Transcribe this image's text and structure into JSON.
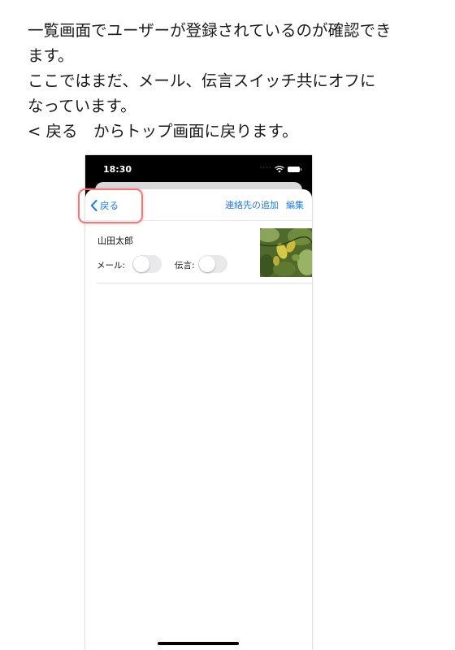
{
  "caption": {
    "lines": [
      "一覧画面でユーザーが登録されているのが確認でき",
      "ます。",
      "ここではまだ、メール、伝言スイッチ共にオフに",
      "なっています。",
      "< 戻る　からトップ画面に戻ります。"
    ]
  },
  "statusbar": {
    "time": "18:30"
  },
  "navbar": {
    "back_label": "戻る",
    "add_contact": "連絡先の追加",
    "edit": "編集"
  },
  "contact": {
    "name": "山田太郎",
    "mail_label": "メール:",
    "mail_on": false,
    "message_label": "伝言:",
    "message_on": false
  },
  "icons": [
    "chevron-left-icon",
    "wifi-icon",
    "battery-icon"
  ],
  "colors": {
    "accent": "#1a7cf2",
    "highlight": "#f07877",
    "toggle_off": "#e9e9eb"
  }
}
